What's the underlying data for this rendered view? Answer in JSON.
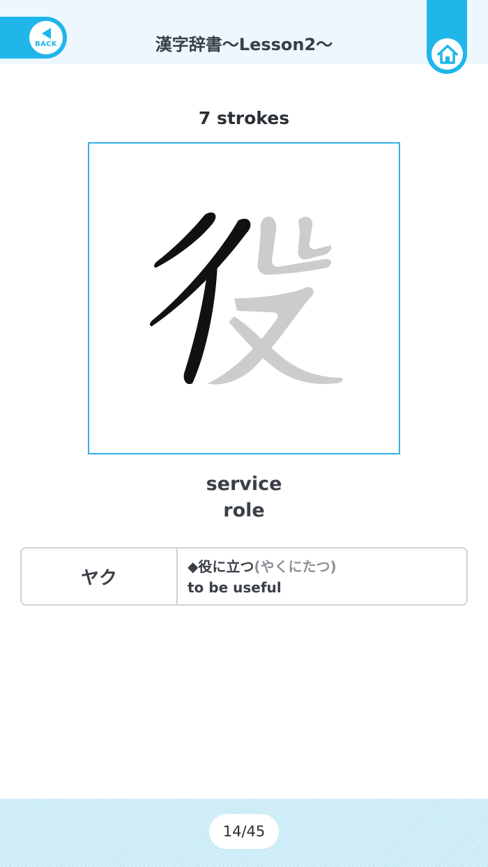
{
  "header": {
    "title": "漢字辞書〜Lesson2〜",
    "back_label": "BACK",
    "back_icon": "back-arrow-icon",
    "home_icon": "home-icon",
    "accent_color": "#1fb6ea"
  },
  "kanji": {
    "stroke_count_text": "7 strokes",
    "character": "役",
    "meanings": [
      "service",
      "role"
    ]
  },
  "readings": [
    {
      "reading": "ヤク",
      "example_word": "◆役に立つ",
      "example_kana": "(やくにたつ)",
      "example_translation": "to be useful"
    }
  ],
  "footer": {
    "page_indicator": "14/45"
  }
}
